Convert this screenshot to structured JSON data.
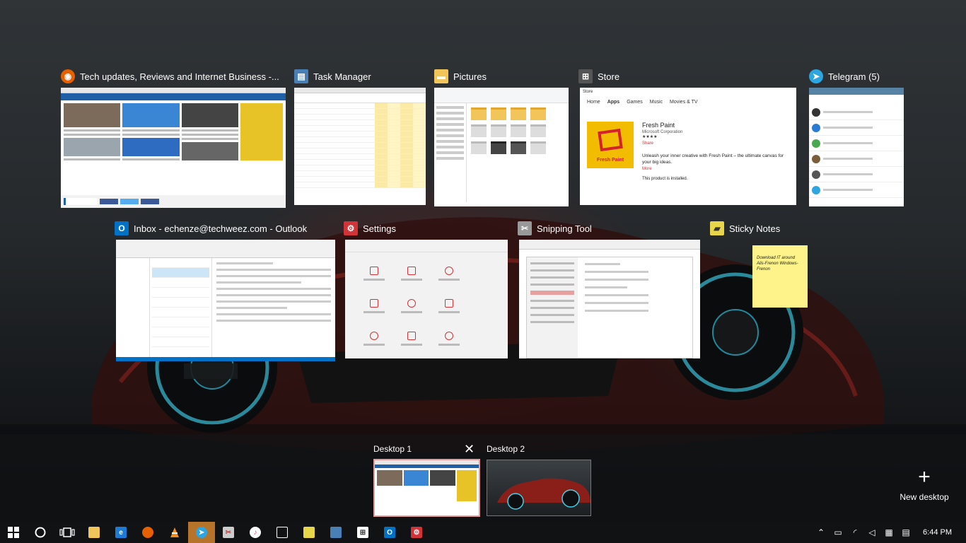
{
  "windows": [
    {
      "id": "firefox",
      "title": "Tech updates, Reviews and Internet Business -...",
      "icon": "firefox-icon",
      "color": "#e66000"
    },
    {
      "id": "taskmgr",
      "title": "Task Manager",
      "icon": "task-manager-icon",
      "color": "#4a7fb5"
    },
    {
      "id": "pictures",
      "title": "Pictures",
      "icon": "folder-icon",
      "color": "#f2c55a"
    },
    {
      "id": "store",
      "title": "Store",
      "icon": "store-icon",
      "color": "#555555"
    },
    {
      "id": "telegram",
      "title": "Telegram (5)",
      "icon": "telegram-icon",
      "color": "#2ca5e0"
    },
    {
      "id": "outlook",
      "title": "Inbox - echenze@techweez.com - Outlook",
      "icon": "outlook-icon",
      "color": "#0072c6"
    },
    {
      "id": "settings",
      "title": "Settings",
      "icon": "settings-icon",
      "color": "#d13438"
    },
    {
      "id": "snipping",
      "title": "Snipping Tool",
      "icon": "snipping-tool-icon",
      "color": "#999999"
    },
    {
      "id": "sticky",
      "title": "Sticky Notes",
      "icon": "sticky-notes-icon",
      "color": "#e8d64a"
    }
  ],
  "store_preview": {
    "window_label": "Store",
    "nav": [
      "Home",
      "Apps",
      "Games",
      "Music",
      "Movies & TV"
    ],
    "app_name": "Fresh Paint",
    "publisher": "Microsoft Corporation",
    "rating_stars": "★★★★",
    "share": "Share",
    "tile_label": "Fresh Paint",
    "description": "Unleash your inner creative with Fresh Paint – the ultimate canvas for your big ideas.",
    "more": "More",
    "installed": "This product is installed."
  },
  "sticky_preview": {
    "text": "Download IT around Alis-Frenon Windows-Frenon"
  },
  "desktops": [
    {
      "label": "Desktop 1",
      "active": true
    },
    {
      "label": "Desktop 2",
      "active": false
    }
  ],
  "desktop_close": "✕",
  "new_desktop": {
    "label": "New desktop",
    "glyph": "+"
  },
  "taskbar": {
    "items": [
      {
        "name": "start-button",
        "icon": "windows-logo-icon"
      },
      {
        "name": "cortana-button",
        "icon": "search-circle-icon"
      },
      {
        "name": "task-view-button",
        "icon": "task-view-icon"
      },
      {
        "name": "taskbar-file-explorer",
        "icon": "folder-icon"
      },
      {
        "name": "taskbar-edge",
        "icon": "edge-icon"
      },
      {
        "name": "taskbar-firefox",
        "icon": "firefox-icon"
      },
      {
        "name": "taskbar-vlc",
        "icon": "vlc-icon"
      },
      {
        "name": "taskbar-telegram",
        "icon": "telegram-icon"
      },
      {
        "name": "taskbar-snipping-tool",
        "icon": "snipping-tool-icon"
      },
      {
        "name": "taskbar-itunes",
        "icon": "music-icon"
      },
      {
        "name": "taskbar-calendar",
        "icon": "calendar-icon"
      },
      {
        "name": "taskbar-sticky-notes",
        "icon": "sticky-notes-icon"
      },
      {
        "name": "taskbar-task-manager",
        "icon": "task-manager-icon"
      },
      {
        "name": "taskbar-store",
        "icon": "store-icon"
      },
      {
        "name": "taskbar-outlook",
        "icon": "outlook-icon"
      },
      {
        "name": "taskbar-settings",
        "icon": "settings-icon"
      }
    ],
    "clock": "6:44 PM"
  }
}
